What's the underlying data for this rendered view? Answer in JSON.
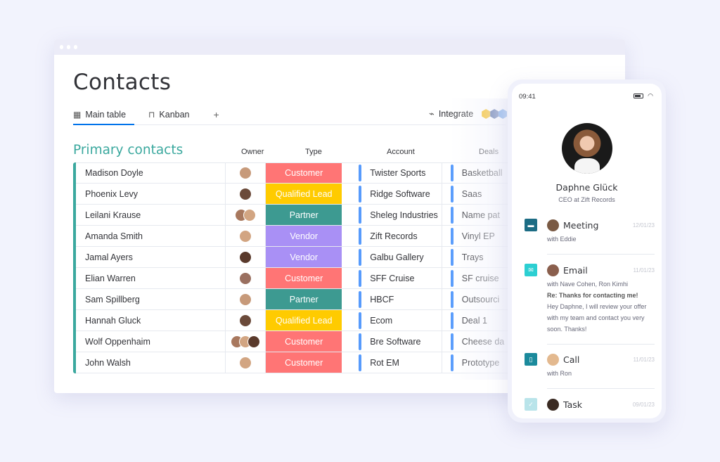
{
  "window": {
    "title": "Contacts",
    "tabs": [
      {
        "label": "Main table",
        "icon": "table-icon",
        "active": true
      },
      {
        "label": "Kanban",
        "icon": "kanban-icon",
        "active": false
      }
    ],
    "add_tab_label": "+",
    "integrate_label": "Integrate"
  },
  "group": {
    "title": "Primary contacts",
    "color": "#3aa89e",
    "columns": {
      "owner": "Owner",
      "type": "Type",
      "account": "Account",
      "deals": "Deals"
    }
  },
  "type_colors": {
    "Customer": "#ff7575",
    "Qualified Lead": "#ffcb00",
    "Partner": "#3d9a91",
    "Vendor": "#a990f5"
  },
  "rows": [
    {
      "name": "Madison Doyle",
      "owners": 1,
      "type": "Customer",
      "account": "Twister Sports",
      "deal": "Basketball"
    },
    {
      "name": "Phoenix Levy",
      "owners": 1,
      "type": "Qualified Lead",
      "account": "Ridge Software",
      "deal": "Saas"
    },
    {
      "name": "Leilani Krause",
      "owners": 2,
      "type": "Partner",
      "account": "Sheleg Industries",
      "deal": "Name pat"
    },
    {
      "name": "Amanda Smith",
      "owners": 1,
      "type": "Vendor",
      "account": "Zift Records",
      "deal": "Vinyl EP"
    },
    {
      "name": "Jamal Ayers",
      "owners": 1,
      "type": "Vendor",
      "account": "Galbu Gallery",
      "deal": "Trays"
    },
    {
      "name": "Elian Warren",
      "owners": 1,
      "type": "Customer",
      "account": "SFF Cruise",
      "deal": "SF cruise"
    },
    {
      "name": "Sam Spillberg",
      "owners": 1,
      "type": "Partner",
      "account": "HBCF",
      "deal": "Outsourci"
    },
    {
      "name": "Hannah Gluck",
      "owners": 1,
      "type": "Qualified Lead",
      "account": "Ecom",
      "deal": "Deal 1"
    },
    {
      "name": "Wolf Oppenhaim",
      "owners": 3,
      "type": "Customer",
      "account": "Bre Software",
      "deal": "Cheese da"
    },
    {
      "name": "John Walsh",
      "owners": 1,
      "type": "Customer",
      "account": "Rot EM",
      "deal": "Prototype"
    }
  ],
  "phone": {
    "time": "09:41",
    "profile": {
      "name": "Daphne Glück",
      "role": "CEO at Zift Records"
    },
    "activities": [
      {
        "title": "Meeting",
        "date": "12/01/23",
        "sub": "with Eddie",
        "icon": "calendar-icon",
        "color": "#1c6c84"
      },
      {
        "title": "Email",
        "date": "11/01/23",
        "sub": "with Nave Cohen, Ron Kimhi",
        "subject": "Re: Thanks for contacting me!",
        "body": "Hey Daphne, I will review your offer with my team and contact you very soon. Thanks!",
        "icon": "mail-icon",
        "color": "#2ccfd2"
      },
      {
        "title": "Call",
        "date": "11/01/23",
        "sub": "with Ron",
        "icon": "phone-icon",
        "color": "#1b8a9c"
      },
      {
        "title": "Task",
        "date": "09/01/23",
        "icon": "checkbox-icon",
        "color": "#b9e4ea"
      }
    ]
  }
}
